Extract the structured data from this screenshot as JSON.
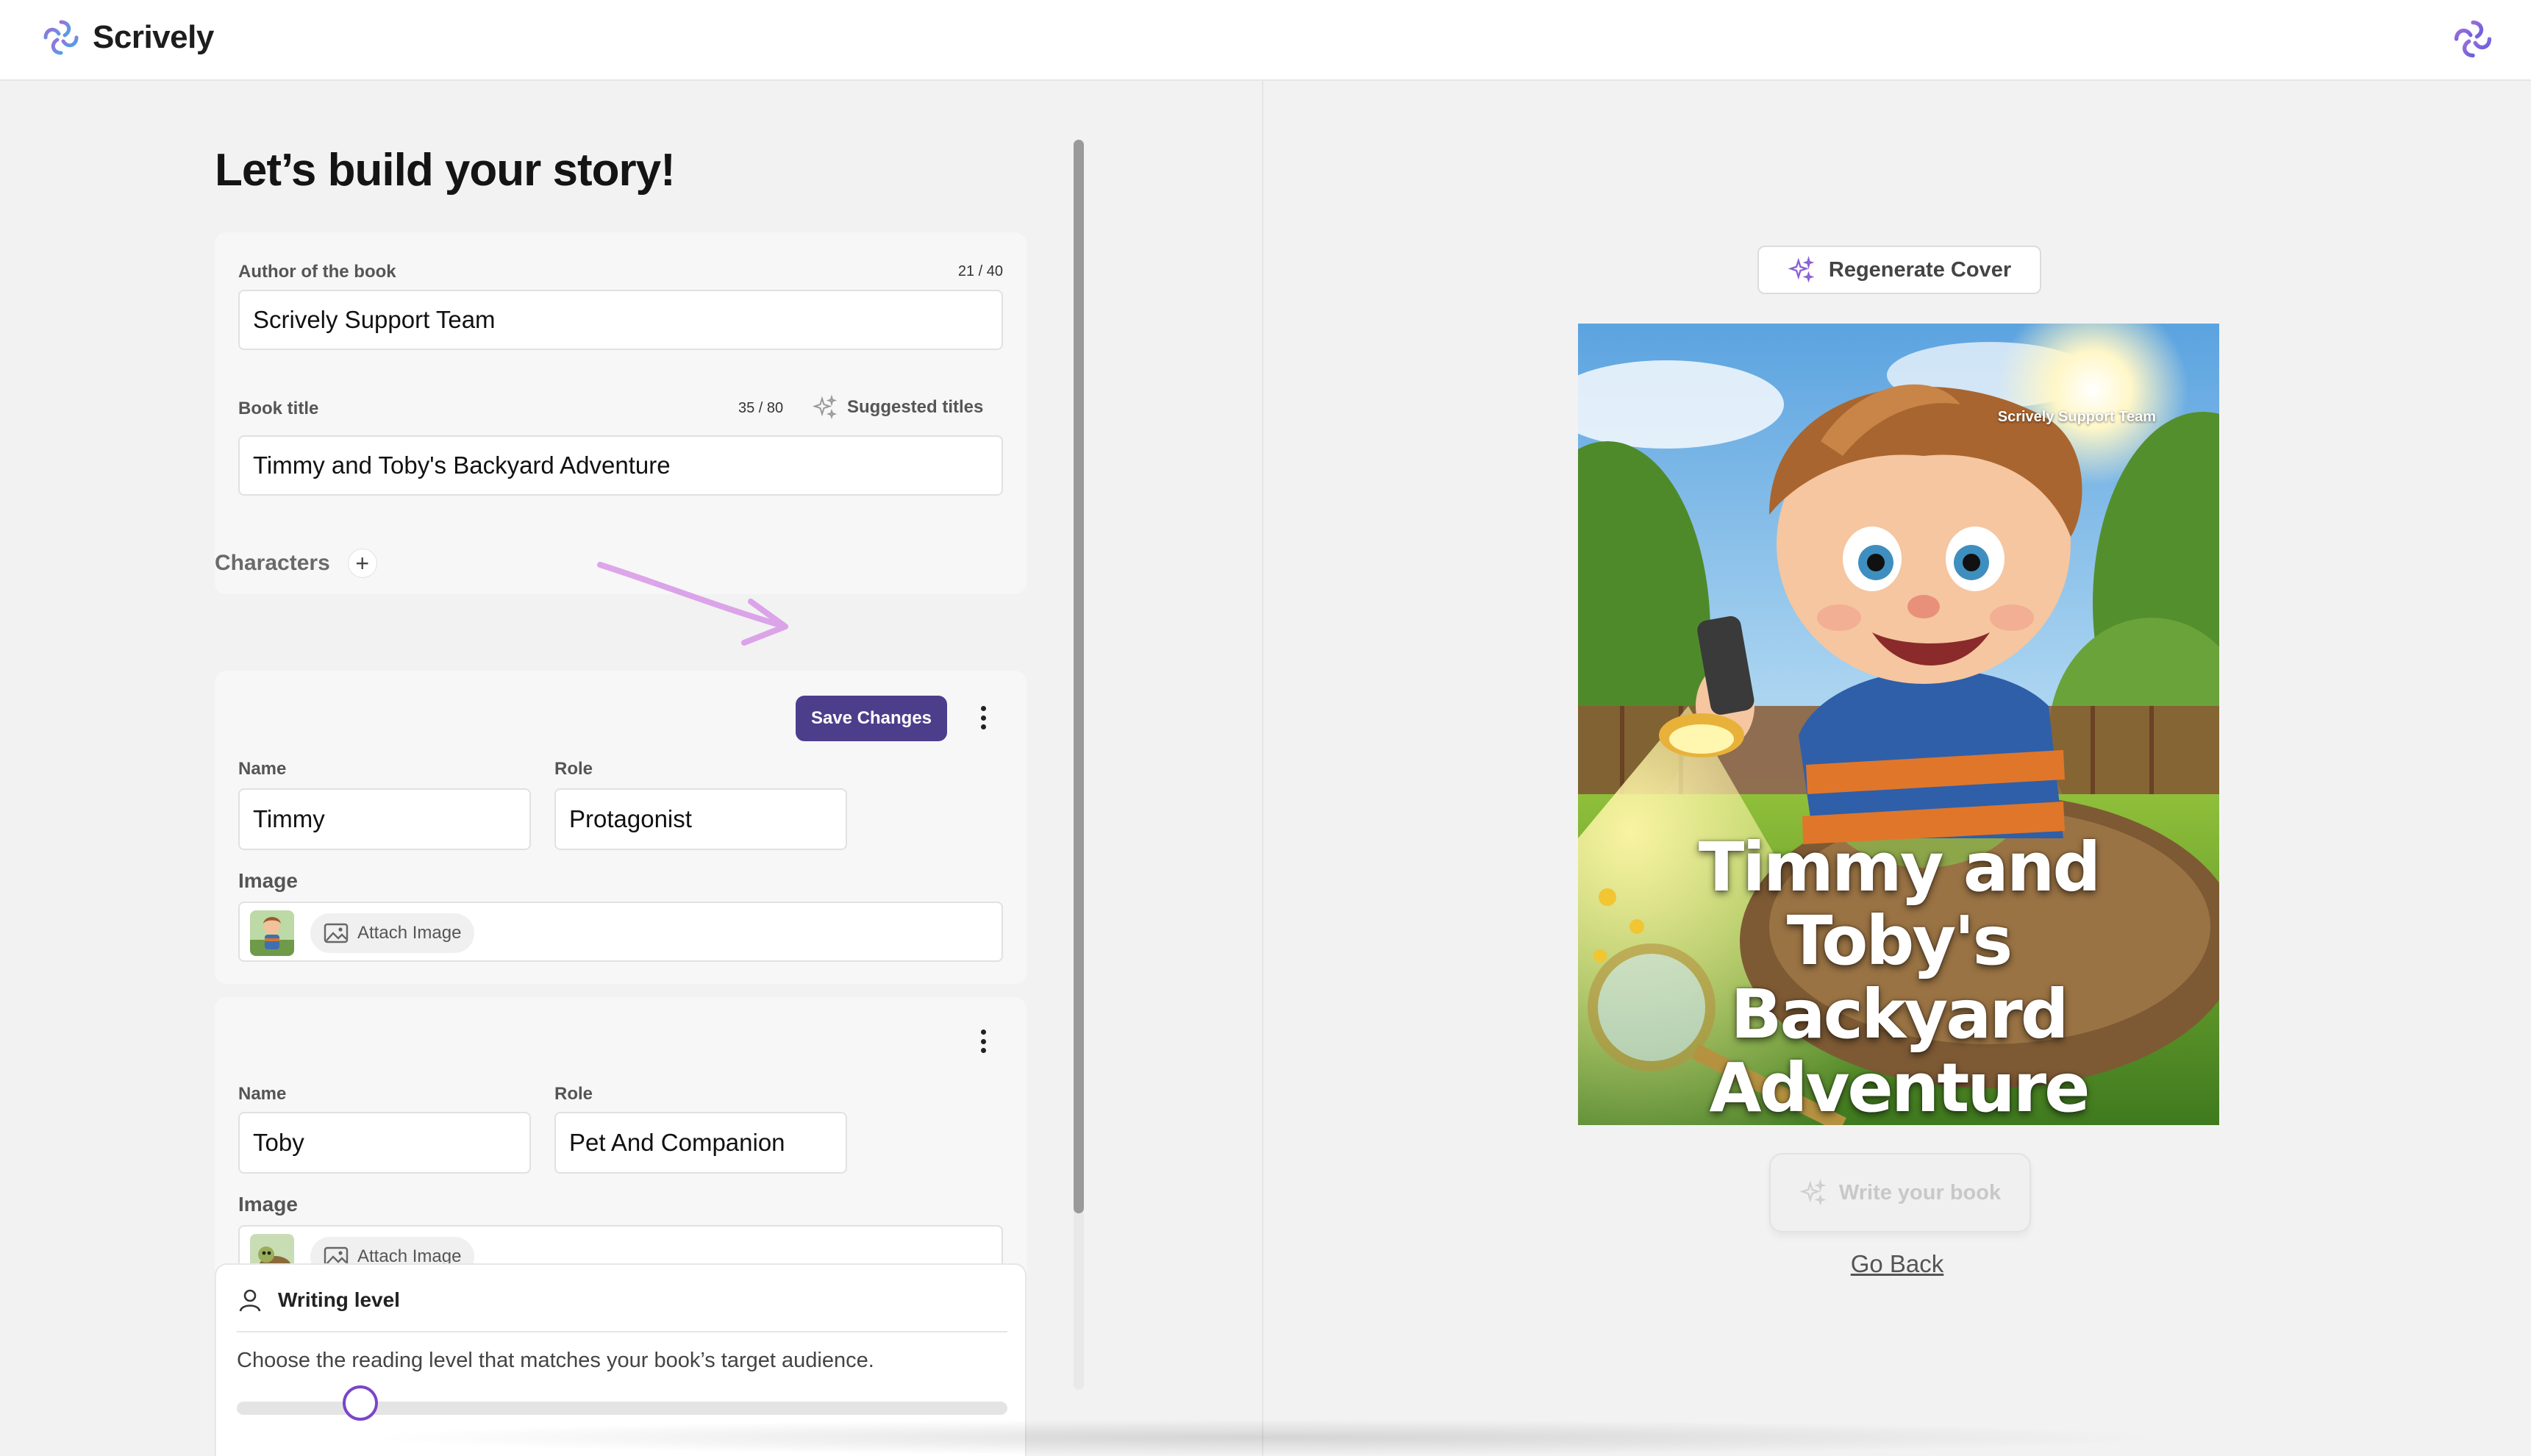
{
  "app": {
    "name": "Scrively",
    "accent_color": "#4d3e8c",
    "brand_gradient": [
      "#8f6bd6",
      "#4fa3e6"
    ]
  },
  "form": {
    "page_title": "Let’s build your story!",
    "author": {
      "label": "Author of the book",
      "counter": "21 / 40",
      "value": "Scrively Support Team"
    },
    "book_title": {
      "label": "Book title",
      "counter": "35 / 80",
      "suggest_label": "Suggested titles",
      "value": "Timmy and Toby's Backyard Adventure"
    }
  },
  "characters": {
    "heading": "Characters",
    "add_icon": "plus-icon",
    "save_label": "Save Changes",
    "items": [
      {
        "name_label": "Name",
        "name": "Timmy",
        "role_label": "Role",
        "role": "Protagonist",
        "image_label": "Image",
        "attach_label": "Attach Image"
      },
      {
        "name_label": "Name",
        "name": "Toby",
        "role_label": "Role",
        "role": "Pet And Companion",
        "image_label": "Image",
        "attach_label": "Attach Image"
      }
    ]
  },
  "writing_level": {
    "title": "Writing level",
    "description": "Choose the reading level that matches your book’s target audience.",
    "slider_value": 0.16
  },
  "preview": {
    "regenerate_label": "Regenerate Cover",
    "cover_title_lines": [
      "Timmy and Toby's",
      "Backyard",
      "Adventure"
    ],
    "cover_author": "Scrively Support Team",
    "write_label": "Write your book",
    "go_back_label": "Go Back"
  }
}
